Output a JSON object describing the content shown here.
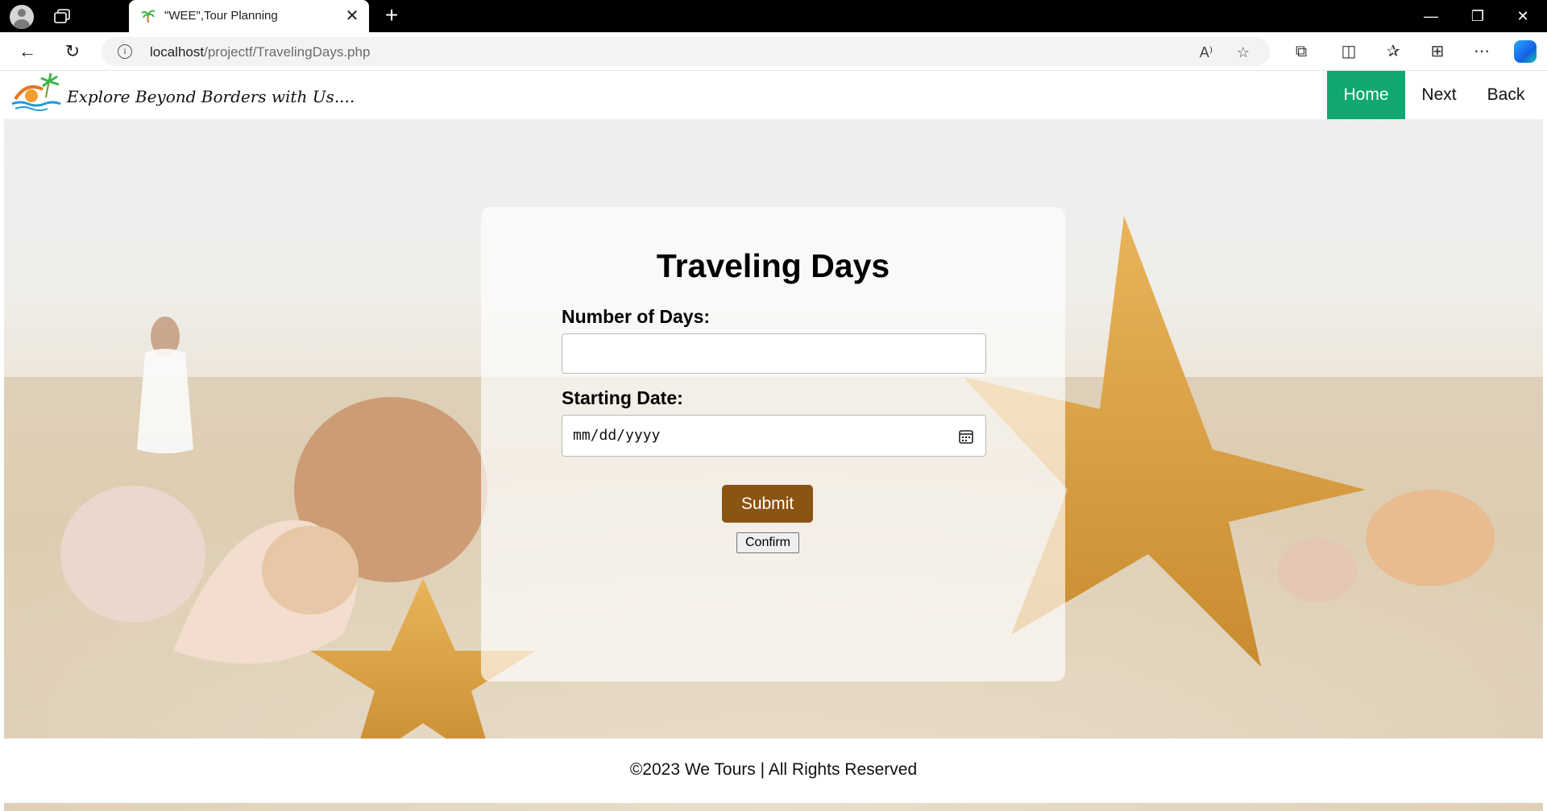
{
  "browser": {
    "tab_title": "\"WEE\",Tour Planning",
    "url_host": "localhost",
    "url_path": "/projectf/TravelingDays.php",
    "icons": [
      "profile-icon",
      "workspaces-icon",
      "close-icon",
      "new-tab-icon",
      "minimize-icon",
      "restore-icon",
      "close-window-icon",
      "back-icon",
      "refresh-icon",
      "info-icon",
      "read-aloud-icon",
      "favorite-star-icon",
      "extensions-icon",
      "split-screen-icon",
      "favorites-icon",
      "collections-icon",
      "more-icon",
      "copilot-icon"
    ]
  },
  "header": {
    "tagline": "Explore Beyond Borders with Us....",
    "nav": {
      "home": "Home",
      "next": "Next",
      "back": "Back"
    },
    "accent_color": "#10a770"
  },
  "form": {
    "title": "Traveling Days",
    "days_label": "Number of Days:",
    "days_value": "",
    "date_label": "Starting Date:",
    "date_placeholder": "mm/dd/yyyy",
    "submit_label": "Submit",
    "submit_color": "#8a5413",
    "confirm_label": "Confirm"
  },
  "footer": {
    "text": "©2023 We Tours | All Rights Reserved"
  }
}
